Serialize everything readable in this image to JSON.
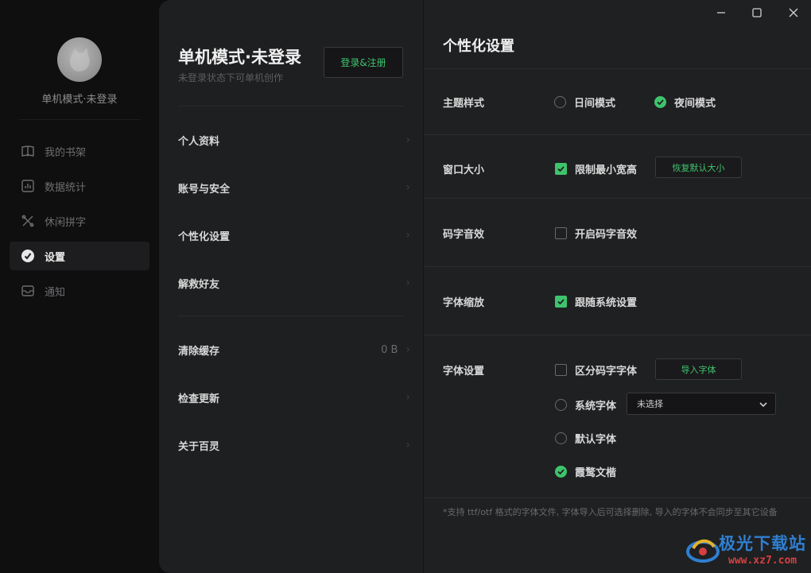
{
  "sidebar": {
    "user_name": "单机模式·未登录",
    "items": [
      {
        "label": "我的书架",
        "icon": "book-icon",
        "active": false
      },
      {
        "label": "数据统计",
        "icon": "chart-icon",
        "active": false
      },
      {
        "label": "休闲拼字",
        "icon": "puzzle-icon",
        "active": false
      },
      {
        "label": "设置",
        "icon": "settings-icon",
        "active": true
      },
      {
        "label": "通知",
        "icon": "mail-icon",
        "active": false
      }
    ]
  },
  "account": {
    "title": "单机模式·未登录",
    "subtitle": "未登录状态下可单机创作",
    "login_label": "登录&注册",
    "menu": [
      {
        "label": "个人资料"
      },
      {
        "label": "账号与安全"
      },
      {
        "label": "个性化设置"
      },
      {
        "label": "解救好友"
      }
    ],
    "menu2": [
      {
        "label": "清除缓存",
        "value": "0 B"
      },
      {
        "label": "检查更新"
      },
      {
        "label": "关于百灵"
      }
    ]
  },
  "settings": {
    "title": "个性化设置",
    "theme": {
      "label": "主题样式",
      "options": [
        {
          "label": "日间模式",
          "selected": false
        },
        {
          "label": "夜间模式",
          "selected": true
        }
      ]
    },
    "window": {
      "label": "窗口大小",
      "limit_label": "限制最小宽高",
      "limit_checked": true,
      "reset_label": "恢复默认大小"
    },
    "sound": {
      "label": "码字音效",
      "enable_label": "开启码字音效",
      "enabled": false
    },
    "zoom": {
      "label": "字体缩放",
      "follow_label": "跟随系统设置",
      "follow_checked": true
    },
    "font": {
      "label": "字体设置",
      "distinguish_label": "区分码字字体",
      "distinguish_checked": false,
      "import_label": "导入字体",
      "system_label": "系统字体",
      "system_select_value": "未选择",
      "default_label": "默认字体",
      "wenkai_label": "霞鹜文楷",
      "selected": "wenkai"
    },
    "note": "*支持 ttf/otf 格式的字体文件, 字体导入后可选择删除, 导入的字体不会同步至其它设备"
  },
  "window_controls": [
    "minimize-icon",
    "maximize-icon",
    "close-icon"
  ],
  "watermark": {
    "text": "极光下载站",
    "url": "www.xz7.com"
  },
  "colors": {
    "accent": "#3ec46d",
    "panel": "#1f2022",
    "sidebar": "#0f0f10"
  }
}
